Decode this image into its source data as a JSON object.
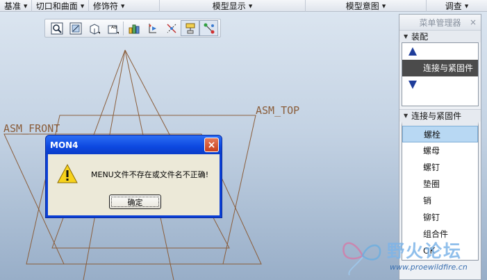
{
  "ribbon": {
    "groups": [
      {
        "label": "基准"
      },
      {
        "label": "切口和曲面"
      },
      {
        "label": "修饰符"
      },
      {
        "label": "模型显示"
      },
      {
        "label": "模型意图"
      },
      {
        "label": "调查"
      }
    ]
  },
  "graphics": {
    "datum_labels": {
      "front": "ASM_FRONT",
      "top": "ASM_TOP"
    }
  },
  "toolbar": {
    "icons": [
      "zoom-icon",
      "refit-icon",
      "display-style-icon",
      "saved-views-icon",
      "view-manager-icon",
      "perspective-icon",
      "datum-display-icon",
      "annotation-display-icon",
      "spin-center-icon"
    ]
  },
  "menu_manager": {
    "title": "菜单管理器",
    "close": "×",
    "section1": "装配",
    "section1_item": "连接与紧固件",
    "section2": "连接与紧固件",
    "items": [
      "螺栓",
      "螺母",
      "螺钉",
      "垫圈",
      "销",
      "铆钉",
      "组合件",
      "OK"
    ]
  },
  "dialog": {
    "title": "MON4",
    "message": "MENU文件不存在或文件名不正确!",
    "ok_label": "确定",
    "close": "×"
  },
  "watermark": {
    "text": "野火论坛",
    "url": "www.proewildfire.cn"
  },
  "colors": {
    "datum": "#8a5d3a",
    "dialog_title": "#0a3fd6",
    "selected_item": "#b8d8f3"
  }
}
